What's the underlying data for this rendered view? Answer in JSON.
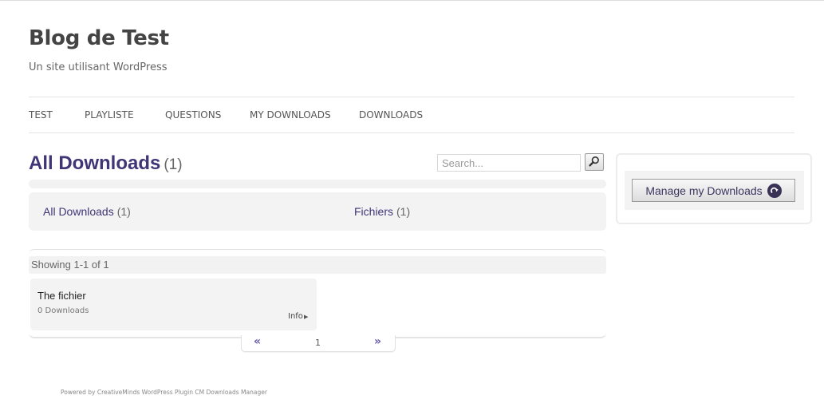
{
  "site": {
    "title": "Blog de Test",
    "description": "Un site utilisant WordPress"
  },
  "nav": {
    "items": [
      {
        "label": "TEST"
      },
      {
        "label": "PLAYLISTE"
      },
      {
        "label": "QUESTIONS"
      },
      {
        "label": "MY DOWNLOADS"
      },
      {
        "label": "DOWNLOADS"
      }
    ]
  },
  "main": {
    "heading": "All Downloads",
    "heading_count": "(1)",
    "search": {
      "placeholder": "Search...",
      "button_icon": "magnifier-icon"
    },
    "categories": [
      {
        "label": "All Downloads",
        "count": "(1)"
      },
      {
        "label": "Fichiers",
        "count": "(1)"
      }
    ],
    "showing": "Showing 1-1 of 1",
    "items": [
      {
        "title": "The fichier",
        "downloads": "0 Downloads",
        "info_label": "Info"
      }
    ],
    "pagination": {
      "prev": "«",
      "current": "1",
      "next": "»"
    }
  },
  "sidebar": {
    "manage_label": "Manage my Downloads",
    "manage_icon": "redo-arrow-icon"
  },
  "footer": {
    "text": "Powered by CreativeMinds WordPress Plugin CM Downloads Manager"
  },
  "colors": {
    "accent": "#3f3577",
    "pager_arrow": "#6a5aa8",
    "panel_bg": "#f3f3f3"
  }
}
